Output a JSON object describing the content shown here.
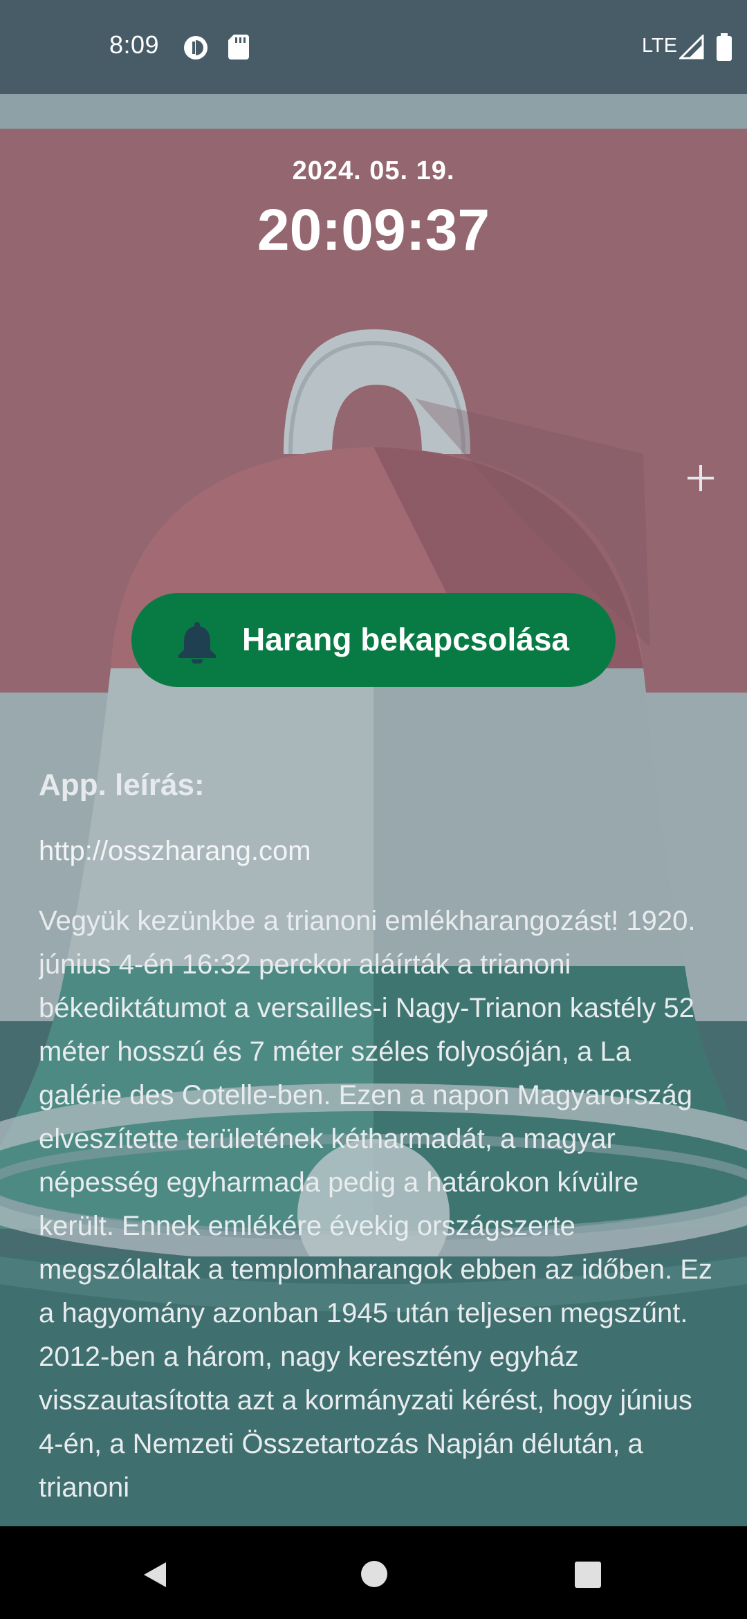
{
  "status_bar": {
    "time": "8:09",
    "network": "LTE",
    "icons": [
      "data-saver-icon",
      "sd-card-icon",
      "signal-icon",
      "battery-icon"
    ]
  },
  "clock": {
    "date": "2024. 05. 19.",
    "time": "20:09:37"
  },
  "actions": {
    "add_icon": "plus-icon",
    "bell_button_label": "Harang bekapcsolása",
    "bell_icon": "bell-icon"
  },
  "description": {
    "title": "App. leírás:",
    "link": "http://osszharang.com",
    "body": "Vegyük kezünkbe a trianoni emlékharangozást! 1920. június 4-én 16:32 perckor aláírták a trianoni békediktátumot a versailles-i Nagy-Trianon kastély 52 méter hosszú és 7 méter széles folyosóján, a La galérie des Cotelle-ben. Ezen a napon Magyarország elveszítette területének kétharmadát, a magyar népesség egyharmada pedig a határokon kívülre került. Ennek emlékére évekig országszerte megszólaltak a templomharangok ebben az időben. Ez a hagyomány azonban 1945 után teljesen megszűnt. 2012-ben a három, nagy keresztény egyház visszautasította azt a kormányzati kérést, hogy június 4-én, a Nemzeti Összetartozás Napján délután, a trianoni"
  },
  "colors": {
    "button_green": "#087b45",
    "status_bar": "#485c67"
  },
  "nav_bar": {
    "icons": [
      "back-icon",
      "home-icon",
      "recents-icon"
    ]
  }
}
